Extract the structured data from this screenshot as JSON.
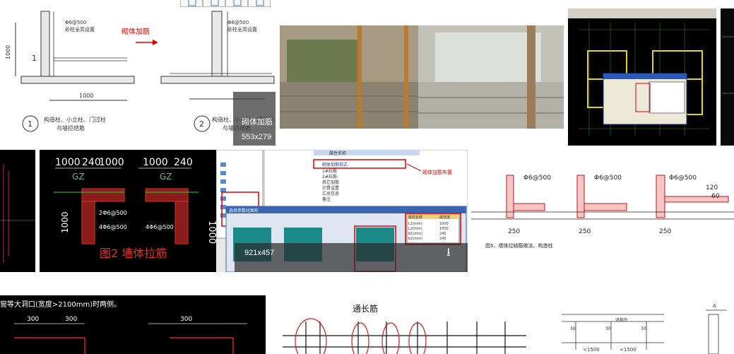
{
  "topstrip": {
    "left_text": "",
    "right_text": ""
  },
  "toolbar": {
    "buttons": [
      "grid-icon",
      "copy-icon",
      "print-icon",
      "share-icon"
    ]
  },
  "images": [
    {
      "id": "img1",
      "labels": {
        "arrow_label": "砌体加筋",
        "note_top1": "Φ6@500",
        "note_top2": "砂柱全高设置",
        "note_top3": "Φ6@500",
        "note_top4": "砂柱全高设置",
        "dim_left": "1000",
        "dim_bottom": "1000",
        "num1": "1",
        "num2": "2",
        "cap1": "构造柱、小立柱、门过柱",
        "cap1b": "与墙拉结筋",
        "cap2": "构造柱、小立柱、门过柱",
        "cap2b": "与墙拉结筋"
      },
      "overlay_title": "砌体加筋",
      "overlay_size": "553x279"
    },
    {
      "id": "img2",
      "kind": "photo"
    },
    {
      "id": "img3",
      "kind": "cad-dark"
    },
    {
      "id": "img4",
      "kind": "cad-dark-partial"
    },
    {
      "id": "img5",
      "labels": {
        "d1": "1000",
        "d2": "240",
        "d3": "1000",
        "d4": "1000",
        "d5": "240",
        "gz1": "GZ",
        "gz2": "GZ",
        "d6": "1000",
        "d7": "240",
        "n1": "2Φ6@500",
        "n2": "4Φ6@500",
        "n3": "4Φ6@500",
        "caption": "图2 墙体拉筋"
      }
    },
    {
      "id": "img6",
      "labels": {
        "header": "属性名称",
        "title": "墙体拉筋设置",
        "dialog_title": "选择参数化图形",
        "red_note": "砌体加筋布置",
        "rows": [
          "砌体加筋形式",
          "1#拉筋",
          "2#拉筋",
          "其它加筋",
          "计算设置",
          "汇总信息",
          "备注"
        ],
        "param_rows": [
          "L1(mm)",
          "L2(mm)",
          "b1(mm)",
          "b2(mm)"
        ],
        "param_vals": [
          "1000",
          "1000",
          "240",
          "240"
        ],
        "param_header": [
          "属性名称",
          "属性值"
        ]
      },
      "overlay_size": "921x457"
    },
    {
      "id": "img7",
      "labels": {
        "n1": "Φ6@500",
        "n2": "Φ6@500",
        "n3": "Φ6@500",
        "d1": "250",
        "d2": "250",
        "d3": "250",
        "d4": "120",
        "d5": "60",
        "foot": "图5、墙体拉结筋做法、构造柱"
      }
    },
    {
      "id": "img8",
      "labels": {
        "top_text": "窗等大洞口(宽度>2100mm)时两侧。",
        "d1": "300",
        "d2": "300",
        "d3": "300"
      }
    },
    {
      "id": "img9",
      "labels": {
        "title": "通长筋"
      }
    },
    {
      "id": "img10",
      "labels": {
        "d1": "<1500",
        "d2": "<1500",
        "d3": "30",
        "d4": "30",
        "d5": "30",
        "n1": "竖筋外"
      }
    },
    {
      "id": "img11",
      "labels": {
        "n1": "A"
      }
    }
  ]
}
